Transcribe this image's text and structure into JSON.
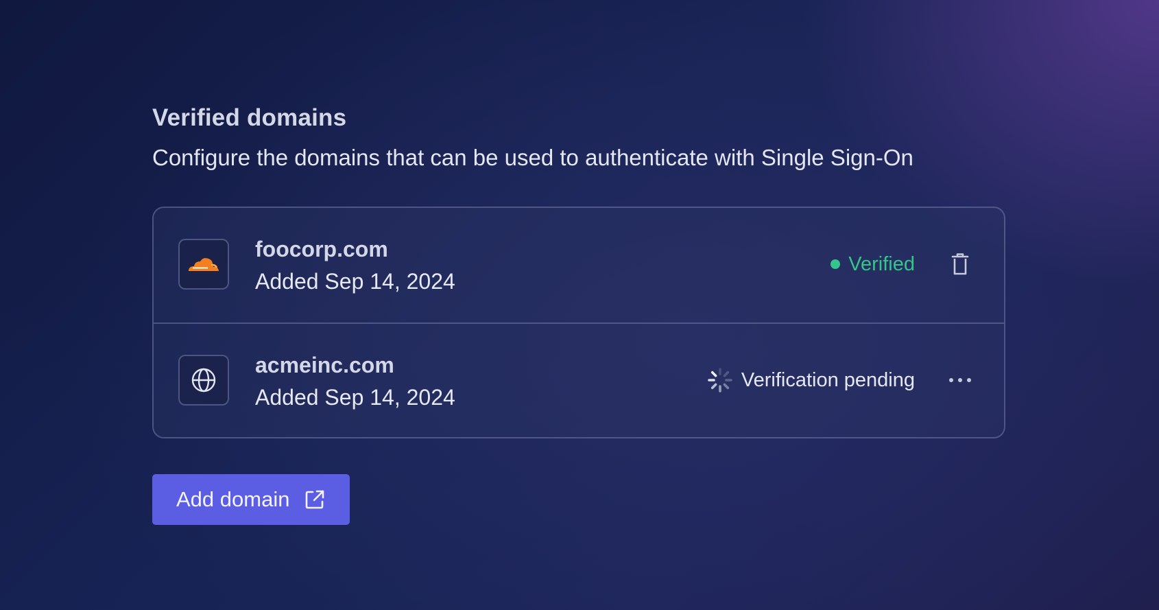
{
  "header": {
    "title": "Verified domains",
    "subtitle": "Configure the domains that can be used to authenticate with Single Sign-On"
  },
  "domains": [
    {
      "name": "foocorp.com",
      "added": "Added Sep 14, 2024",
      "icon": "cloudflare-icon",
      "status": "Verified",
      "status_color": "#34c58b",
      "action_icon": "trash-icon"
    },
    {
      "name": "acmeinc.com",
      "added": "Added Sep 14, 2024",
      "icon": "globe-icon",
      "status": "Verification pending",
      "status_color": "#e6e8f2",
      "action_icon": "more-icon"
    }
  ],
  "add_button": {
    "label": "Add domain",
    "icon": "external-link-icon",
    "color": "#5b5de3"
  },
  "colors": {
    "background": "#182353",
    "accent_purple": "#623e98",
    "cloudflare_orange": "#f38020"
  }
}
